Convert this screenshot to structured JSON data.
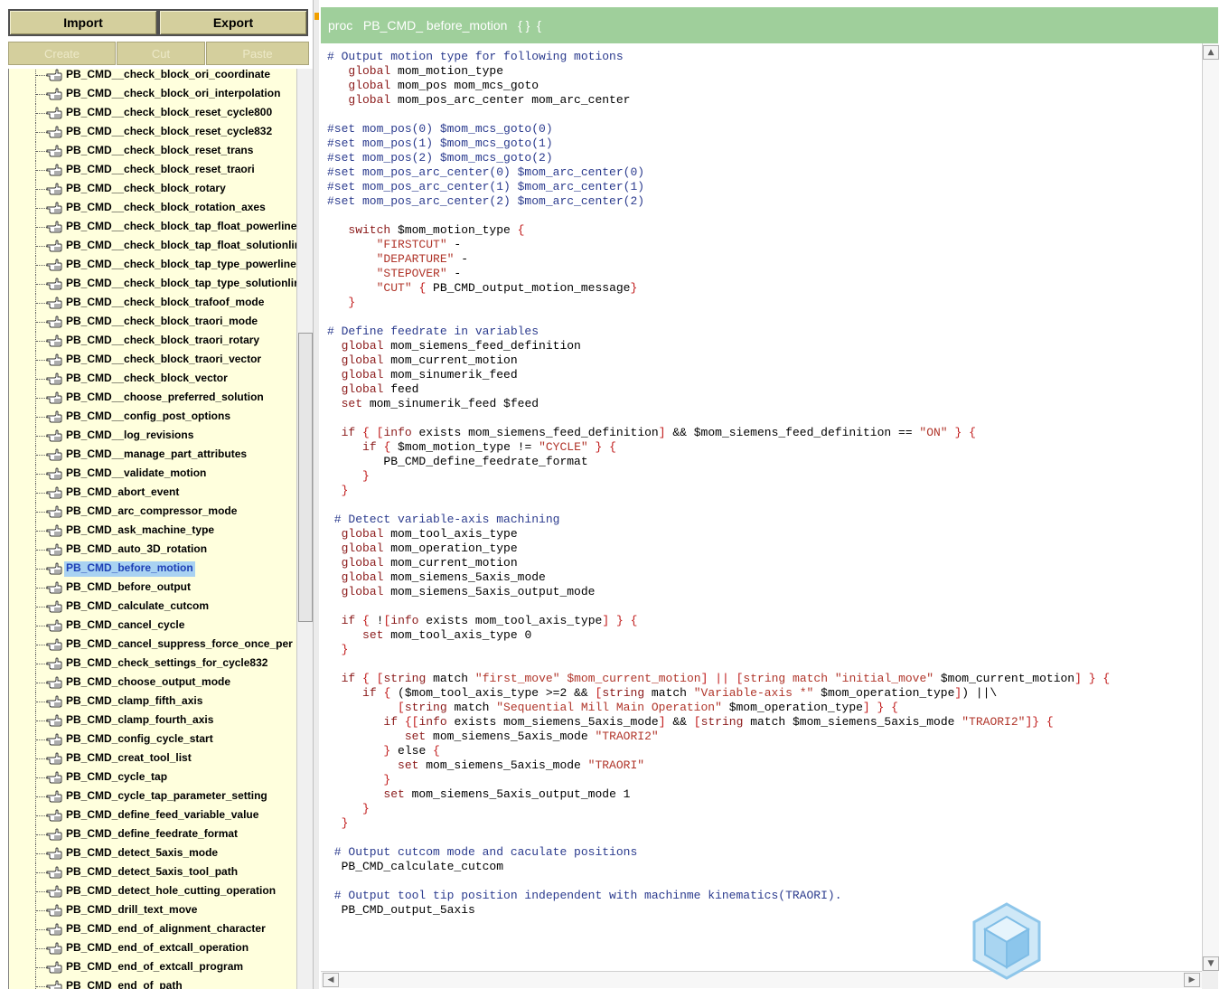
{
  "toolbar": {
    "import_label": "Import",
    "export_label": "Export",
    "create_label": "Create",
    "cut_label": "Cut",
    "paste_label": "Paste"
  },
  "tree": {
    "selected_index": 26,
    "items": [
      "PB_CMD__check_block_ori_coordinate",
      "PB_CMD__check_block_ori_interpolation",
      "PB_CMD__check_block_reset_cycle800",
      "PB_CMD__check_block_reset_cycle832",
      "PB_CMD__check_block_reset_trans",
      "PB_CMD__check_block_reset_traori",
      "PB_CMD__check_block_rotary",
      "PB_CMD__check_block_rotation_axes",
      "PB_CMD__check_block_tap_float_powerline",
      "PB_CMD__check_block_tap_float_solutionline",
      "PB_CMD__check_block_tap_type_powerline",
      "PB_CMD__check_block_tap_type_solutionline",
      "PB_CMD__check_block_trafoof_mode",
      "PB_CMD__check_block_traori_mode",
      "PB_CMD__check_block_traori_rotary",
      "PB_CMD__check_block_traori_vector",
      "PB_CMD__check_block_vector",
      "PB_CMD__choose_preferred_solution",
      "PB_CMD__config_post_options",
      "PB_CMD__log_revisions",
      "PB_CMD__manage_part_attributes",
      "PB_CMD__validate_motion",
      "PB_CMD_abort_event",
      "PB_CMD_arc_compressor_mode",
      "PB_CMD_ask_machine_type",
      "PB_CMD_auto_3D_rotation",
      "PB_CMD_before_motion",
      "PB_CMD_before_output",
      "PB_CMD_calculate_cutcom",
      "PB_CMD_cancel_cycle",
      "PB_CMD_cancel_suppress_force_once_per",
      "PB_CMD_check_settings_for_cycle832",
      "PB_CMD_choose_output_mode",
      "PB_CMD_clamp_fifth_axis",
      "PB_CMD_clamp_fourth_axis",
      "PB_CMD_config_cycle_start",
      "PB_CMD_creat_tool_list",
      "PB_CMD_cycle_tap",
      "PB_CMD_cycle_tap_parameter_setting",
      "PB_CMD_define_feed_variable_value",
      "PB_CMD_define_feedrate_format",
      "PB_CMD_detect_5axis_mode",
      "PB_CMD_detect_5axis_tool_path",
      "PB_CMD_detect_hole_cutting_operation",
      "PB_CMD_drill_text_move",
      "PB_CMD_end_of_alignment_character",
      "PB_CMD_end_of_extcall_operation",
      "PB_CMD_end_of_extcall_program",
      "PB_CMD_end_of_path"
    ]
  },
  "editor": {
    "proc_keyword": "proc",
    "proc_name": "PB_CMD_ before_motion",
    "proc_args": "{ }",
    "proc_brace": "{",
    "lines": [
      [
        [
          "# Output motion type for following motions",
          "cm"
        ]
      ],
      [
        [
          "   "
        ],
        [
          "global",
          "kw"
        ],
        [
          " mom_motion_type"
        ]
      ],
      [
        [
          "   "
        ],
        [
          "global",
          "kw"
        ],
        [
          " mom_pos mom_mcs_goto"
        ]
      ],
      [
        [
          "   "
        ],
        [
          "global",
          "kw"
        ],
        [
          " mom_pos_arc_center mom_arc_center"
        ]
      ],
      [],
      [
        [
          "#set mom_pos(0) $mom_mcs_goto(0)",
          "cm"
        ]
      ],
      [
        [
          "#set mom_pos(1) $mom_mcs_goto(1)",
          "cm"
        ]
      ],
      [
        [
          "#set mom_pos(2) $mom_mcs_goto(2)",
          "cm"
        ]
      ],
      [
        [
          "#set mom_pos_arc_center(0) $mom_arc_center(0)",
          "cm"
        ]
      ],
      [
        [
          "#set mom_pos_arc_center(1) $mom_arc_center(1)",
          "cm"
        ]
      ],
      [
        [
          "#set mom_pos_arc_center(2) $mom_arc_center(2)",
          "cm"
        ]
      ],
      [],
      [
        [
          "   "
        ],
        [
          "switch",
          "kw"
        ],
        [
          " $mom_motion_type "
        ],
        [
          "{",
          "br"
        ]
      ],
      [
        [
          "       "
        ],
        [
          "\"FIRSTCUT\"",
          "sv"
        ],
        [
          " -"
        ]
      ],
      [
        [
          "       "
        ],
        [
          "\"DEPARTURE\"",
          "sv"
        ],
        [
          " -"
        ]
      ],
      [
        [
          "       "
        ],
        [
          "\"STEPOVER\"",
          "sv"
        ],
        [
          " -"
        ]
      ],
      [
        [
          "       "
        ],
        [
          "\"CUT\"",
          "sv"
        ],
        [
          " "
        ],
        [
          "{",
          "br"
        ],
        [
          " PB_CMD_output_motion_message"
        ],
        [
          "}",
          "br"
        ]
      ],
      [
        [
          "   "
        ],
        [
          "}",
          "br"
        ]
      ],
      [],
      [
        [
          "# Define feedrate in variables",
          "cm"
        ]
      ],
      [
        [
          "  "
        ],
        [
          "global",
          "kw"
        ],
        [
          " mom_siemens_feed_definition"
        ]
      ],
      [
        [
          "  "
        ],
        [
          "global",
          "kw"
        ],
        [
          " mom_current_motion"
        ]
      ],
      [
        [
          "  "
        ],
        [
          "global",
          "kw"
        ],
        [
          " mom_sinumerik_feed"
        ]
      ],
      [
        [
          "  "
        ],
        [
          "global",
          "kw"
        ],
        [
          " feed"
        ]
      ],
      [
        [
          "  "
        ],
        [
          "set",
          "kw"
        ],
        [
          " mom_sinumerik_feed $feed"
        ]
      ],
      [],
      [
        [
          "  "
        ],
        [
          "if",
          "kw"
        ],
        [
          " "
        ],
        [
          "{",
          "br"
        ],
        [
          " "
        ],
        [
          "[",
          "br"
        ],
        [
          "info",
          "kw"
        ],
        [
          " exists mom_siemens_feed_definition"
        ],
        [
          "]",
          "br"
        ],
        [
          " && $mom_siemens_feed_definition == "
        ],
        [
          "\"ON\"",
          "sv"
        ],
        [
          " "
        ],
        [
          "}",
          "br"
        ],
        [
          " "
        ],
        [
          "{",
          "br"
        ]
      ],
      [
        [
          "     "
        ],
        [
          "if",
          "kw"
        ],
        [
          " "
        ],
        [
          "{",
          "br"
        ],
        [
          " $mom_motion_type != "
        ],
        [
          "\"CYCLE\"",
          "sv"
        ],
        [
          " "
        ],
        [
          "}",
          "br"
        ],
        [
          " "
        ],
        [
          "{",
          "br"
        ]
      ],
      [
        [
          "        PB_CMD_define_feedrate_format"
        ]
      ],
      [
        [
          "     "
        ],
        [
          "}",
          "br"
        ]
      ],
      [
        [
          "  "
        ],
        [
          "}",
          "br"
        ]
      ],
      [],
      [
        [
          " # Detect variable-axis machining",
          "cm"
        ]
      ],
      [
        [
          "  "
        ],
        [
          "global",
          "kw"
        ],
        [
          " mom_tool_axis_type"
        ]
      ],
      [
        [
          "  "
        ],
        [
          "global",
          "kw"
        ],
        [
          " mom_operation_type"
        ]
      ],
      [
        [
          "  "
        ],
        [
          "global",
          "kw"
        ],
        [
          " mom_current_motion"
        ]
      ],
      [
        [
          "  "
        ],
        [
          "global",
          "kw"
        ],
        [
          " mom_siemens_5axis_mode"
        ]
      ],
      [
        [
          "  "
        ],
        [
          "global",
          "kw"
        ],
        [
          " mom_siemens_5axis_output_mode"
        ]
      ],
      [],
      [
        [
          "  "
        ],
        [
          "if",
          "kw"
        ],
        [
          " "
        ],
        [
          "{",
          "br"
        ],
        [
          " !"
        ],
        [
          "[",
          "br"
        ],
        [
          "info",
          "kw"
        ],
        [
          " exists mom_tool_axis_type"
        ],
        [
          "]",
          "br"
        ],
        [
          " "
        ],
        [
          "}",
          "br"
        ],
        [
          " "
        ],
        [
          "{",
          "br"
        ]
      ],
      [
        [
          "     "
        ],
        [
          "set",
          "kw"
        ],
        [
          " mom_tool_axis_type 0"
        ]
      ],
      [
        [
          "  "
        ],
        [
          "}",
          "br"
        ]
      ],
      [],
      [
        [
          "  "
        ],
        [
          "if",
          "kw"
        ],
        [
          " "
        ],
        [
          "{",
          "br"
        ],
        [
          " "
        ],
        [
          "[",
          "br"
        ],
        [
          "string",
          "kw"
        ],
        [
          " match "
        ],
        [
          "\"first_move\"",
          "sv"
        ],
        [
          " "
        ],
        [
          "$mom_current_motion",
          "sv"
        ],
        [
          "]",
          "br"
        ],
        [
          " "
        ],
        [
          "||",
          "br"
        ],
        [
          " "
        ],
        [
          "[",
          "br"
        ],
        [
          "string match",
          "sv"
        ],
        [
          " "
        ],
        [
          "\"initial_move\"",
          "sv"
        ],
        [
          " $mom_current_motion"
        ],
        [
          "]",
          "br"
        ],
        [
          " "
        ],
        [
          "}",
          "br"
        ],
        [
          " "
        ],
        [
          "{",
          "br"
        ]
      ],
      [
        [
          "     "
        ],
        [
          "if",
          "kw"
        ],
        [
          " "
        ],
        [
          "{",
          "br"
        ],
        [
          " ($mom_tool_axis_type >=2 && "
        ],
        [
          "[",
          "br"
        ],
        [
          "string",
          "kw"
        ],
        [
          " match "
        ],
        [
          "\"Variable-axis *\"",
          "sv"
        ],
        [
          " $mom_operation_type"
        ],
        [
          "]",
          "br"
        ],
        [
          ") ||\\"
        ]
      ],
      [
        [
          "          "
        ],
        [
          "[",
          "br"
        ],
        [
          "string",
          "kw"
        ],
        [
          " match "
        ],
        [
          "\"Sequential Mill Main Operation\"",
          "sv"
        ],
        [
          " $mom_operation_type"
        ],
        [
          "]",
          "br"
        ],
        [
          " "
        ],
        [
          "}",
          "br"
        ],
        [
          " "
        ],
        [
          "{",
          "br"
        ]
      ],
      [
        [
          "        "
        ],
        [
          "if",
          "kw"
        ],
        [
          " "
        ],
        [
          "{",
          "br"
        ],
        [
          "[",
          "br"
        ],
        [
          "info",
          "kw"
        ],
        [
          " exists mom_siemens_5axis_mode"
        ],
        [
          "]",
          "br"
        ],
        [
          " && "
        ],
        [
          "[",
          "br"
        ],
        [
          "string",
          "kw"
        ],
        [
          " match $mom_siemens_5axis_mode "
        ],
        [
          "\"TRAORI2\"",
          "sv"
        ],
        [
          "]",
          "br"
        ],
        [
          "}",
          "br"
        ],
        [
          " "
        ],
        [
          "{",
          "br"
        ]
      ],
      [
        [
          "           "
        ],
        [
          "set",
          "kw"
        ],
        [
          " mom_siemens_5axis_mode "
        ],
        [
          "\"TRAORI2\"",
          "sv"
        ]
      ],
      [
        [
          "        "
        ],
        [
          "}",
          "br"
        ],
        [
          " else "
        ],
        [
          "{",
          "br"
        ]
      ],
      [
        [
          "          "
        ],
        [
          "set",
          "kw"
        ],
        [
          " mom_siemens_5axis_mode "
        ],
        [
          "\"TRAORI\"",
          "sv"
        ]
      ],
      [
        [
          "        "
        ],
        [
          "}",
          "br"
        ]
      ],
      [
        [
          "        "
        ],
        [
          "set",
          "kw"
        ],
        [
          " mom_siemens_5axis_output_mode 1"
        ]
      ],
      [
        [
          "     "
        ],
        [
          "}",
          "br"
        ]
      ],
      [
        [
          "  "
        ],
        [
          "}",
          "br"
        ]
      ],
      [],
      [
        [
          " # Output cutcom mode and caculate positions",
          "cm"
        ]
      ],
      [
        [
          "  PB_CMD_calculate_cutcom"
        ]
      ],
      [],
      [
        [
          " # Output tool tip position independent with machinme kinematics(TRAORI).",
          "cm"
        ]
      ],
      [
        [
          "  PB_CMD_output_5axis"
        ]
      ]
    ]
  },
  "colors": {
    "header_bg": "#9fcf9b",
    "tree_bg": "#ffffdd",
    "button_bg": "#d4cf9d",
    "selection_bg": "#a9d2f2"
  }
}
